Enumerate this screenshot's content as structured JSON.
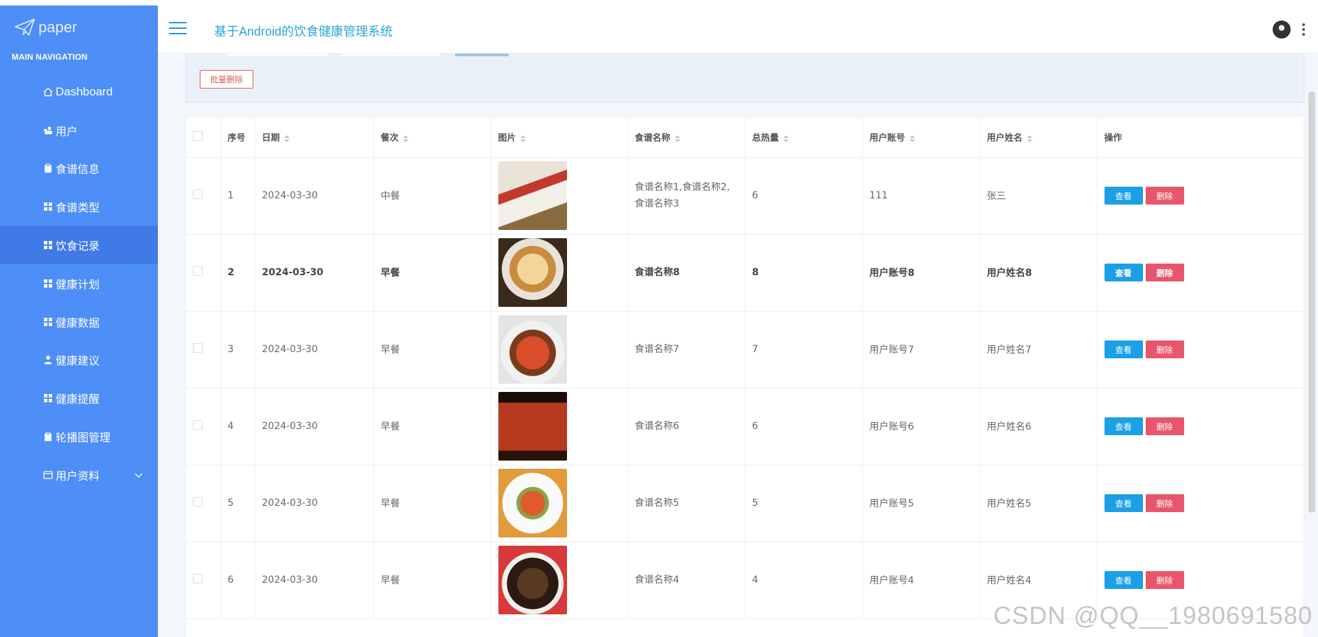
{
  "sidebar": {
    "logo_text": "paper",
    "nav_heading": "MAIN NAVIGATION",
    "items": [
      {
        "label": "Dashboard",
        "icon": "home-icon"
      },
      {
        "label": "用户",
        "icon": "users-icon"
      },
      {
        "label": "食谱信息",
        "icon": "clipboard-icon"
      },
      {
        "label": "食谱类型",
        "icon": "grid-icon"
      },
      {
        "label": "饮食记录",
        "icon": "grid-icon",
        "active": true
      },
      {
        "label": "健康计划",
        "icon": "grid-icon"
      },
      {
        "label": "健康数据",
        "icon": "grid-icon"
      },
      {
        "label": "健康建议",
        "icon": "user-icon"
      },
      {
        "label": "健康提醒",
        "icon": "grid-icon"
      },
      {
        "label": "轮播图管理",
        "icon": "clipboard-icon"
      },
      {
        "label": "用户资料",
        "icon": "id-card-icon",
        "has_children": true
      }
    ]
  },
  "header": {
    "title": "基于Android的饮食健康管理系统"
  },
  "toolbar": {
    "batch_delete_label": "批量删除"
  },
  "table": {
    "columns": [
      "序号",
      "日期",
      "餐次",
      "图片",
      "食谱名称",
      "总热量",
      "用户账号",
      "用户姓名",
      "操作"
    ],
    "view_label": "查看",
    "delete_label": "删除",
    "rows": [
      {
        "no": "1",
        "date": "2024-03-30",
        "meal": "中餐",
        "image": "food-photo-1",
        "recipe": "食谱名称1,食谱名称2,食谱名称3",
        "calories": "6",
        "account": "111",
        "name": "张三"
      },
      {
        "no": "2",
        "date": "2024-03-30",
        "meal": "早餐",
        "image": "food-photo-2",
        "recipe": "食谱名称8",
        "calories": "8",
        "account": "用户账号8",
        "name": "用户姓名8"
      },
      {
        "no": "3",
        "date": "2024-03-30",
        "meal": "早餐",
        "image": "food-photo-3",
        "recipe": "食谱名称7",
        "calories": "7",
        "account": "用户账号7",
        "name": "用户姓名7"
      },
      {
        "no": "4",
        "date": "2024-03-30",
        "meal": "早餐",
        "image": "food-photo-4",
        "recipe": "食谱名称6",
        "calories": "6",
        "account": "用户账号6",
        "name": "用户姓名6"
      },
      {
        "no": "5",
        "date": "2024-03-30",
        "meal": "早餐",
        "image": "food-photo-5",
        "recipe": "食谱名称5",
        "calories": "5",
        "account": "用户账号5",
        "name": "用户姓名5"
      },
      {
        "no": "6",
        "date": "2024-03-30",
        "meal": "早餐",
        "image": "food-photo-6",
        "recipe": "食谱名称4",
        "calories": "4",
        "account": "用户账号4",
        "name": "用户姓名4"
      }
    ]
  },
  "watermark": "CSDN @QQ__1980691580",
  "colors": {
    "sidebar": "#4d8ef7",
    "sidebar_active": "#3f7ae6",
    "title": "#2ca5d6",
    "view_button": "#1b9fe6",
    "delete_button": "#e8566c"
  }
}
